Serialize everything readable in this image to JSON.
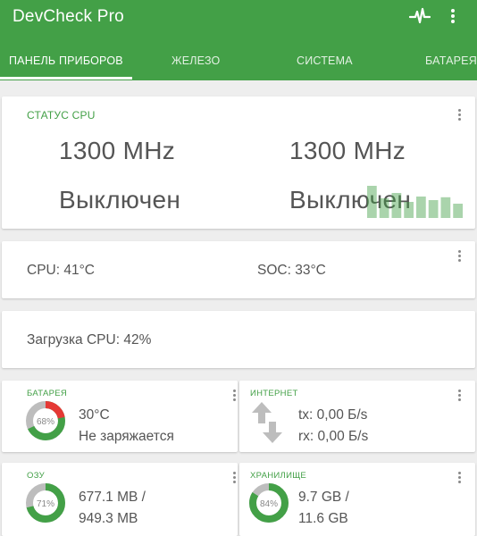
{
  "app": {
    "title": "DevCheck Pro"
  },
  "tabs": [
    {
      "label": "ПАНЕЛЬ ПРИБОРОВ",
      "active": true
    },
    {
      "label": "ЖЕЛЕЗО"
    },
    {
      "label": "СИСТЕМА"
    },
    {
      "label": "БАТАРЕЯ"
    }
  ],
  "cpu_status": {
    "title": "СТАТУС CPU",
    "core1": {
      "freq": "1300 MHz",
      "state": "Выключен"
    },
    "core2": {
      "freq": "1300 MHz",
      "state": "Выключен"
    }
  },
  "temps": {
    "cpu": "CPU: 41°C",
    "soc": "SOC: 33°C"
  },
  "load": {
    "text": "Загрузка CPU: 42%"
  },
  "battery": {
    "title": "БАТАРЕЯ",
    "percent_label": "68%",
    "percent": 68,
    "temp": "30°C",
    "status": "Не заряжается"
  },
  "internet": {
    "title": "ИНТЕРНЕТ",
    "tx": "tx: 0,00 Б/s",
    "rx": "rx: 0,00 Б/s"
  },
  "ram": {
    "title": "ОЗУ",
    "percent_label": "71%",
    "percent": 71,
    "line1": "677.1 MB /",
    "line2": "949.3 MB"
  },
  "storage": {
    "title": "ХРАНИЛИЩЕ",
    "percent_label": "84%",
    "percent": 84,
    "line1": "9.7 GB /",
    "line2": "11.6 GB"
  },
  "colors": {
    "primary": "#43a047",
    "battery_ring": "#e53935",
    "text": "#555555"
  },
  "icons": {
    "pulse": "pulse-icon",
    "more": "more-vert-icon",
    "transfer": "swap-vert-icon"
  },
  "cpu_load_bars": [
    0.9,
    0.55,
    0.7,
    0.45,
    0.6,
    0.5,
    0.58,
    0.4
  ]
}
